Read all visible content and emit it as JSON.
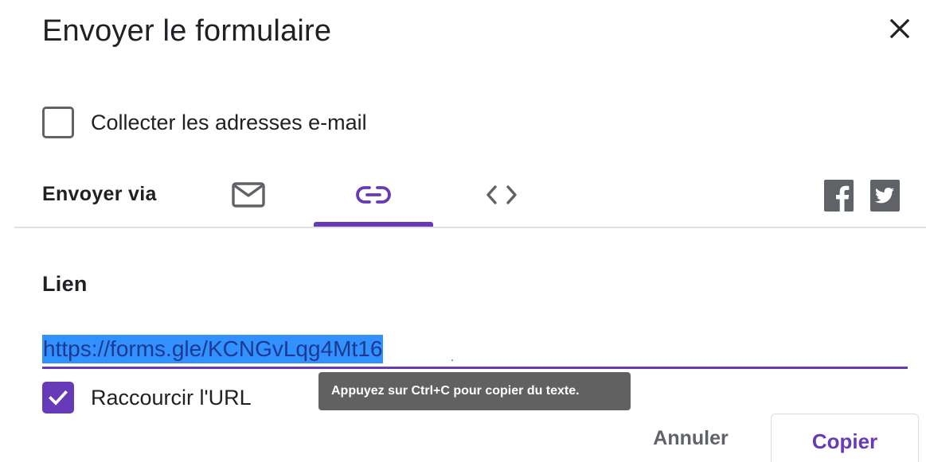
{
  "dialog": {
    "title": "Envoyer le formulaire",
    "collect_emails_label": "Collecter les adresses e-mail",
    "collect_emails_checked": false,
    "send_via_label": "Envoyer via",
    "tabs": [
      {
        "icon": "email-icon",
        "selected": false
      },
      {
        "icon": "link-icon",
        "selected": true
      },
      {
        "icon": "embed-code-icon",
        "selected": false
      }
    ],
    "social": [
      {
        "icon": "facebook-icon"
      },
      {
        "icon": "twitter-icon"
      }
    ],
    "link_section": {
      "title": "Lien",
      "url": "https://forms.gle/KCNGvLqg4Mt16",
      "shorten_label": "Raccourcir l'URL",
      "shorten_checked": true
    },
    "tooltip": "Appuyez sur Ctrl+C pour copier du texte.",
    "buttons": {
      "cancel": "Annuler",
      "copy": "Copier"
    },
    "colors": {
      "accent": "#673ab7",
      "selection": "#3390ff",
      "tooltip_bg": "#616161"
    }
  }
}
